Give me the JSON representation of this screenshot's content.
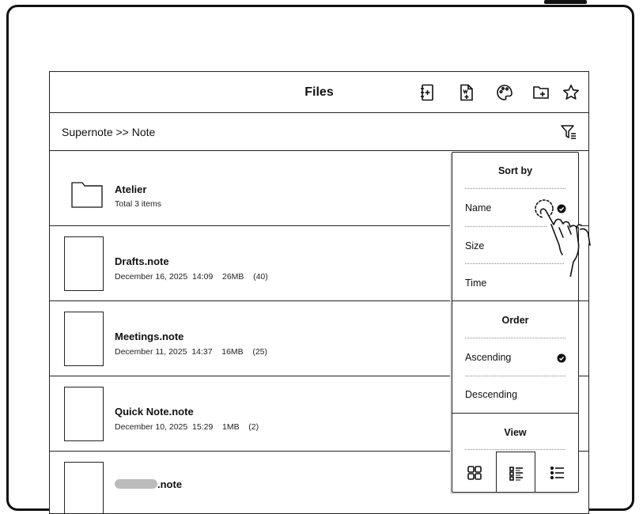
{
  "header": {
    "title": "Files"
  },
  "path": {
    "breadcrumb": "Supernote >> Note"
  },
  "files": [
    {
      "name": "Atelier",
      "meta": "Total 3 items",
      "type": "folder"
    },
    {
      "name": "Drafts.note",
      "meta": "December 16, 2025  14:09    26MB    (40)",
      "type": "note"
    },
    {
      "name": "Meetings.note",
      "meta": "December 11, 2025  14:37    16MB    (25)",
      "type": "note"
    },
    {
      "name": "Quick Note.note",
      "meta": "December 10, 2025  15:29    1MB    (2)",
      "type": "note"
    },
    {
      "name": ".note",
      "meta": "",
      "type": "note"
    }
  ],
  "sort_panel": {
    "sort_title": "Sort by",
    "sort_options": [
      "Name",
      "Size",
      "Time"
    ],
    "sort_selected": "Name",
    "order_title": "Order",
    "order_options": [
      "Ascending",
      "Descending"
    ],
    "order_selected": "Ascending",
    "view_title": "View",
    "view_options": [
      "grid-view-icon",
      "detail-list-view-icon",
      "list-view-icon"
    ],
    "view_selected": "detail-list-view-icon"
  },
  "toolbar_icons": [
    "new-notebook-icon",
    "new-document-icon",
    "palette-icon",
    "new-folder-icon",
    "star-icon"
  ]
}
